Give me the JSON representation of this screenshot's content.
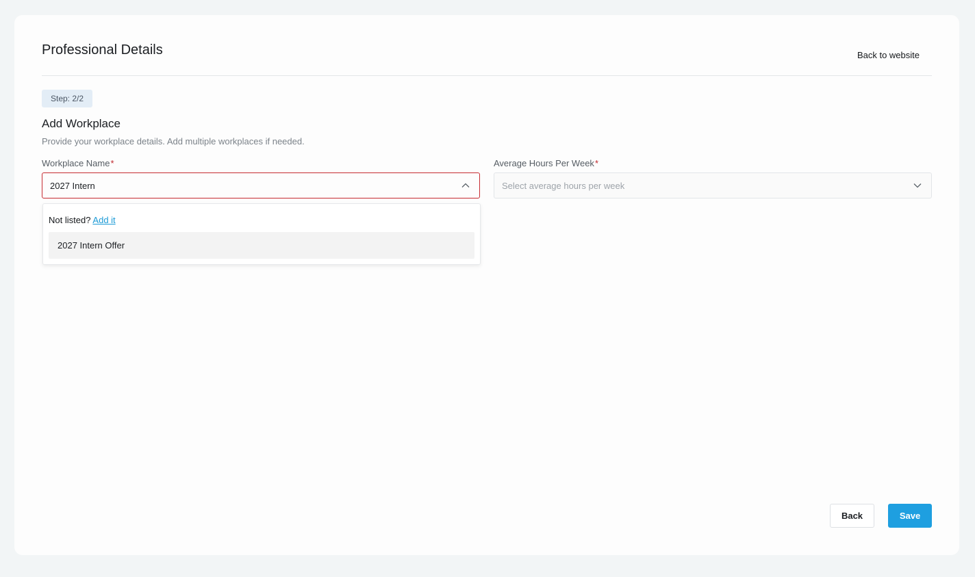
{
  "header": {
    "title": "Professional Details",
    "back_link": "Back to website"
  },
  "step": {
    "label": "Step: 2/2"
  },
  "section": {
    "title": "Add Workplace",
    "description": "Provide your workplace details. Add multiple workplaces if needed."
  },
  "fields": {
    "workplace": {
      "label": "Workplace Name",
      "required_mark": "*",
      "value": "2027 Intern"
    },
    "hours": {
      "label": "Average Hours Per Week",
      "required_mark": "*",
      "placeholder": "Select average hours per week"
    }
  },
  "dropdown": {
    "not_listed_text": "Not listed?",
    "add_link": "Add it",
    "options": [
      "2027 Intern Offer"
    ]
  },
  "actions": {
    "back_label": "Back",
    "save_label": "Save"
  },
  "colors": {
    "accent": "#1e9fe0",
    "error_border": "#c62b31",
    "required": "#c0282d",
    "link": "#1b9ad6",
    "badge_bg": "#e3edf6"
  },
  "icons": {
    "workplace_chevron": "chevron-up-icon",
    "hours_chevron": "chevron-down-icon"
  }
}
